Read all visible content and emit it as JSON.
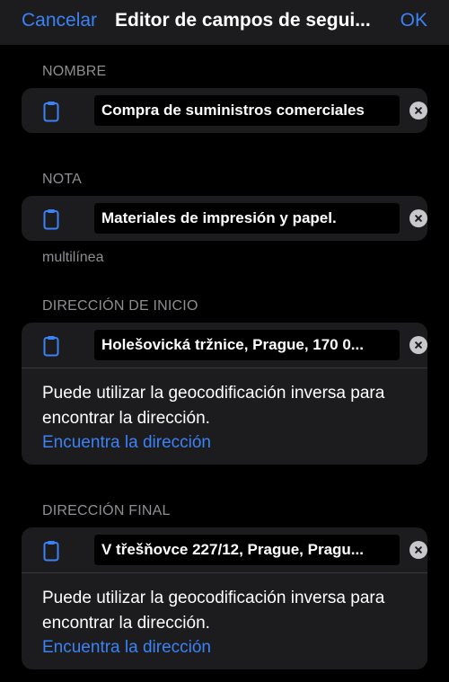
{
  "navbar": {
    "cancel_label": "Cancelar",
    "title": "Editor de campos de segui...",
    "ok_label": "OK"
  },
  "sections": {
    "name": {
      "header": "NOMBRE",
      "value": "Compra de suministros comerciales"
    },
    "note": {
      "header": "NOTA",
      "value": "Materiales de impresión y papel.",
      "footnote": "multilínea"
    },
    "start_address": {
      "header": "DIRECCIÓN DE INICIO",
      "value": "Holešovická tržnice, Prague, 170 0...",
      "description": "Puede utilizar la geocodificación inversa para encontrar la dirección.",
      "link": "Encuentra la dirección"
    },
    "end_address": {
      "header": "DIRECCIÓN FINAL",
      "value": "V třešňovce 227/12, Prague, Pragu...",
      "description": "Puede utilizar la geocodificación inversa para encontrar la dirección.",
      "link": "Encuentra la dirección"
    }
  },
  "colors": {
    "accent": "#3b82f6",
    "background": "#000000",
    "card": "#1c1c1e",
    "secondary_text": "#8e8e93"
  },
  "icons": {
    "field_icon": "clipboard-icon",
    "clear_icon": "clear-icon"
  }
}
